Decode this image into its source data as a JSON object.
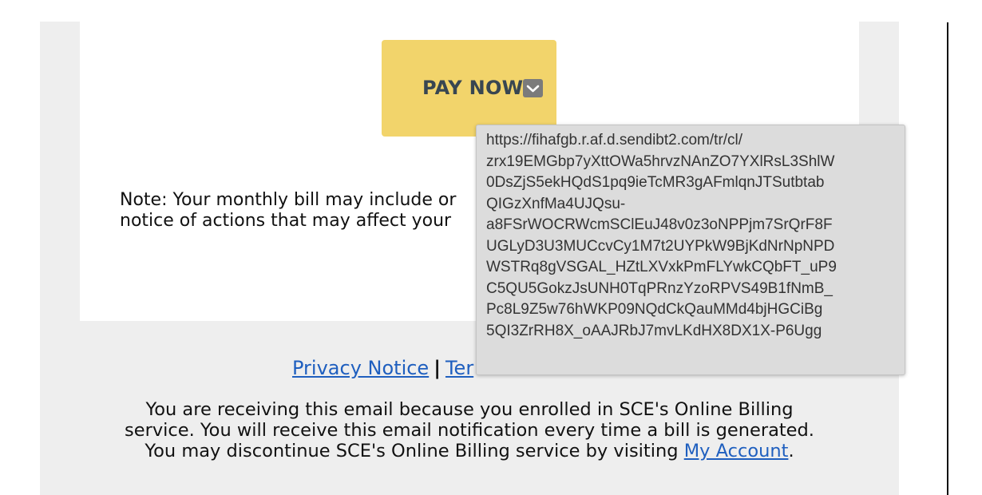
{
  "email": {
    "pay_button_label": "PAY NOW",
    "note_lines": [
      "Note: Your monthly bill may include or",
      "notice of actions that may affect your"
    ],
    "footer_links": {
      "privacy_label": "Privacy Notice",
      "separator": "|",
      "terms_label_partial": "Ter"
    },
    "footer_text_before_link": "You are receiving this email because you enrolled in SCE's Online Billing service. You will receive this email notification every time a bill is generated. You may discontinue SCE's Online Billing service by visiting ",
    "footer_link_label": "My Account",
    "footer_text_after_link": "."
  },
  "tooltip": {
    "url_lines": [
      "https://fihafgb.r.af.d.sendibt2.com/tr/cl/",
      "zrx19EMGbp7yXttOWa5hrvzNAnZO7YXlRsL3ShlW",
      "0DsZjS5ekHQdS1pq9ieTcMR3gAFmlqnJTSutbtab",
      "QIGzXnfMa4UJQsu-",
      "a8FSrWOCRWcmSClEuJ48v0z3oNPPjm7SrQrF8F",
      "UGLyD3U3MUCcvCy1M7t2UYPkW9BjKdNrNpNPD",
      "WSTRq8gVSGAL_HZtLXVxkPmFLYwkCQbFT_uP9",
      "C5QU5GokzJsUNH0TqPRnzYzoRPVS49B1fNmB_",
      "Pc8L9Z5w76hWKP09NQdCkQauMMd4bjHGCiBg",
      "5QI3ZrRH8X_oAAJRbJ7mvLKdHX8DX1X-P6Ugg"
    ]
  },
  "icons": {
    "pay_arrow": "chevron-down-icon"
  },
  "colors": {
    "pay_button": "#f2d46b",
    "pay_text": "#384651",
    "link": "#1f5fbf",
    "email_bg": "#eeeeee",
    "tooltip_bg": "#dcdcdc"
  }
}
